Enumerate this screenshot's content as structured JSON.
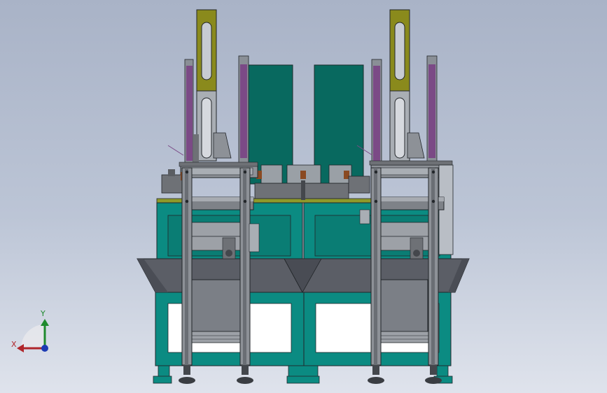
{
  "viewport": {
    "background_top": "#a9b3c7",
    "background_bottom": "#dfe3ec"
  },
  "colors": {
    "teal_frame": "#0b8b82",
    "teal_panel": "#08695f",
    "olive_arm": "#8a8a1c",
    "purple_rail": "#7b4a86",
    "gray_steel": "#6e7176",
    "light_steel": "#a9aeb4",
    "dark_line": "#22262a",
    "copper": "#8a4a22"
  },
  "triad": {
    "x_label": "X",
    "y_label": "Y",
    "x_color": "#b0262b",
    "y_color": "#1f8a2e",
    "z_color": "#1d3bb3",
    "icon": "coordinate-triad-icon"
  }
}
